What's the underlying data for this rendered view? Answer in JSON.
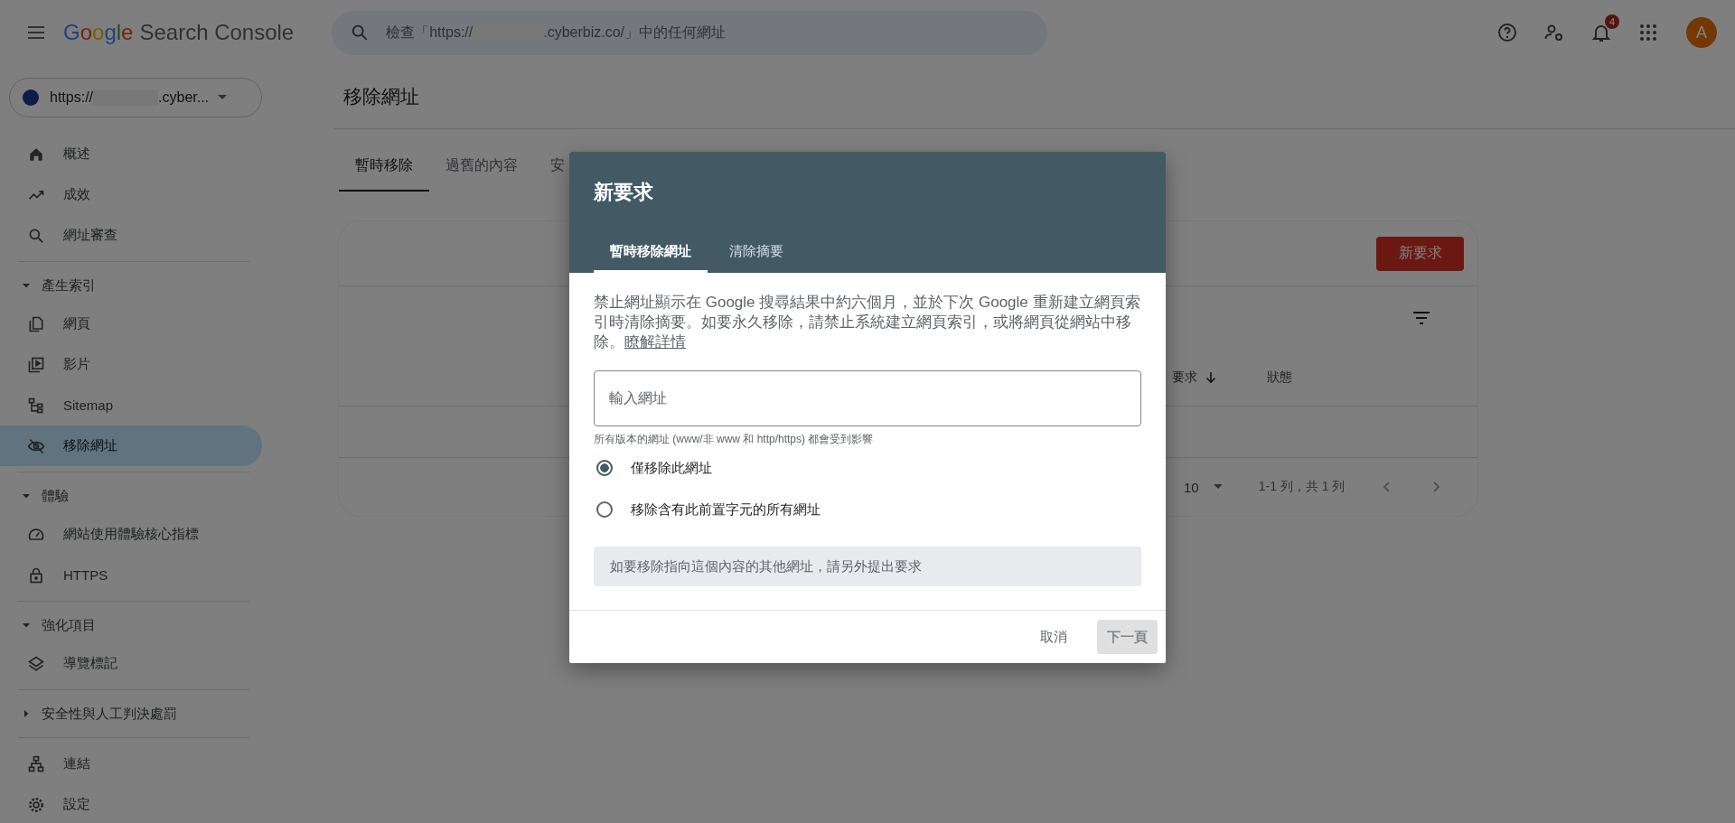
{
  "app_title": {
    "brand": "Google",
    "product": "Search Console"
  },
  "search": {
    "prefix": "檢查「https://",
    "suffix": ".cyberbiz.co/」中的任何網址"
  },
  "notifications": {
    "count": "4"
  },
  "avatar": {
    "initial": "A"
  },
  "property": {
    "prefix": "https://",
    "suffix": ".cyber..."
  },
  "sidebar": {
    "items": [
      {
        "kind": "link",
        "label": "概述",
        "selected": false
      },
      {
        "kind": "link",
        "label": "成效",
        "selected": false
      },
      {
        "kind": "link",
        "label": "網址審查",
        "selected": false
      },
      {
        "kind": "section",
        "label": "產生索引",
        "expanded": true
      },
      {
        "kind": "link",
        "label": "網頁",
        "selected": false
      },
      {
        "kind": "link",
        "label": "影片",
        "selected": false
      },
      {
        "kind": "link",
        "label": "Sitemap",
        "selected": false
      },
      {
        "kind": "link",
        "label": "移除網址",
        "selected": true
      },
      {
        "kind": "section",
        "label": "體驗",
        "expanded": true
      },
      {
        "kind": "link",
        "label": "網站使用體驗核心指標",
        "selected": false
      },
      {
        "kind": "link",
        "label": "HTTPS",
        "selected": false
      },
      {
        "kind": "section",
        "label": "強化項目",
        "expanded": true
      },
      {
        "kind": "link",
        "label": "導覽標記",
        "selected": false
      },
      {
        "kind": "section",
        "label": "安全性與人工判決處罰",
        "expanded": false
      },
      {
        "kind": "link",
        "label": "連結",
        "selected": false
      },
      {
        "kind": "link",
        "label": "設定",
        "selected": false
      }
    ]
  },
  "page": {
    "title": "移除網址",
    "tabs": [
      {
        "label": "暫時移除",
        "selected": true
      },
      {
        "label": "過舊的內容",
        "selected": false
      },
      {
        "label": "安",
        "selected": false
      }
    ]
  },
  "card": {
    "new_request": "新要求",
    "columns": [
      {
        "label": "要求",
        "sorted": true
      },
      {
        "label": "狀態",
        "sorted": false
      }
    ],
    "rows_per_page": "10",
    "range": "1-1 列，共 1 列"
  },
  "dialog": {
    "title": "新要求",
    "tabs": [
      {
        "label": "暫時移除網址",
        "selected": true
      },
      {
        "label": "清除摘要",
        "selected": false
      }
    ],
    "description": "禁止網址顯示在 Google 搜尋結果中約六個月，並於下次 Google 重新建立網頁索引時清除摘要。如要永久移除，請禁止系統建立網頁索引，或將網頁從網站中移除。",
    "learn_more": "瞭解詳情",
    "url_field": {
      "placeholder": "輸入網址"
    },
    "helper": "所有版本的網址 (www/非 www 和 http/https) 都會受到影響",
    "options": [
      {
        "label": "僅移除此網址",
        "selected": true
      },
      {
        "label": "移除含有此前置字元的所有網址",
        "selected": false
      }
    ],
    "notice": "如要移除指向這個內容的其他網址，請另外提出要求",
    "buttons": [
      {
        "kind": "text",
        "label": "取消",
        "disabled": false
      },
      {
        "kind": "filled",
        "label": "下一頁",
        "disabled": true
      }
    ]
  }
}
